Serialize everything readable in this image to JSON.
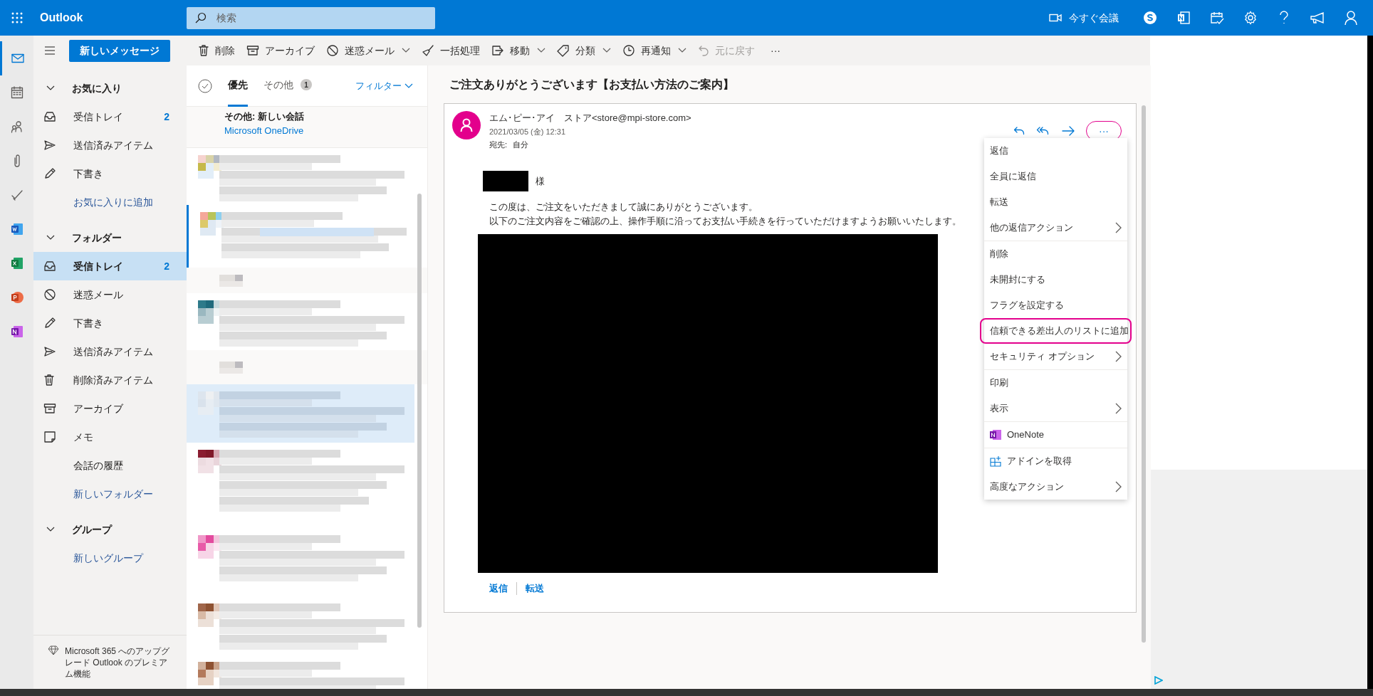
{
  "top_bar": {
    "app_name": "Outlook",
    "search": {
      "placeholder": "検索"
    },
    "meet_now": "今すぐ会議",
    "icons": [
      {
        "kind": "skype"
      },
      {
        "kind": "feed"
      },
      {
        "kind": "calendar-check"
      },
      {
        "kind": "settings"
      },
      {
        "kind": "help"
      },
      {
        "kind": "megaphone"
      },
      {
        "kind": "account"
      }
    ]
  },
  "app_rail": [
    {
      "kind": "mail",
      "selected": true
    },
    {
      "kind": "calendar",
      "selected": false
    },
    {
      "kind": "people",
      "selected": false
    },
    {
      "kind": "attach",
      "selected": false
    },
    {
      "kind": "todo",
      "selected": false
    },
    {
      "kind": "word",
      "selected": false
    },
    {
      "kind": "excel",
      "selected": false
    },
    {
      "kind": "powerpoint",
      "selected": false
    },
    {
      "kind": "onenote",
      "selected": false
    }
  ],
  "new_message_button": "新しいメッセージ",
  "toolbar": {
    "items": [
      {
        "label": "削除",
        "kind": "delete",
        "dropdown": false,
        "disabled": false
      },
      {
        "label": "アーカイブ",
        "kind": "archive",
        "dropdown": false,
        "disabled": false
      },
      {
        "label": "迷惑メール",
        "kind": "junk",
        "dropdown": true,
        "disabled": false
      },
      {
        "label": "一括処理",
        "kind": "sweep",
        "dropdown": false,
        "disabled": false
      },
      {
        "label": "移動",
        "kind": "move",
        "dropdown": true,
        "disabled": false
      },
      {
        "label": "分類",
        "kind": "tag",
        "dropdown": true,
        "disabled": false
      },
      {
        "label": "再通知",
        "kind": "snooze",
        "dropdown": true,
        "disabled": false
      },
      {
        "label": "元に戻す",
        "kind": "undo",
        "dropdown": false,
        "disabled": true
      }
    ],
    "more": "···"
  },
  "nav": {
    "sections": [
      {
        "title": "お気に入り",
        "expanded": true,
        "items": [
          {
            "label": "受信トレイ",
            "kind": "inbox",
            "count": "2",
            "selected": false
          },
          {
            "label": "送信済みアイテム",
            "kind": "sent",
            "selected": false
          },
          {
            "label": "下書き",
            "kind": "drafts",
            "selected": false
          },
          {
            "label": "お気に入りに追加",
            "kind": "link",
            "selected": false
          }
        ]
      },
      {
        "title": "フォルダー",
        "expanded": true,
        "items": [
          {
            "label": "受信トレイ",
            "kind": "inbox",
            "count": "2",
            "selected": true
          },
          {
            "label": "迷惑メール",
            "kind": "junk",
            "selected": false
          },
          {
            "label": "下書き",
            "kind": "drafts",
            "selected": false
          },
          {
            "label": "送信済みアイテム",
            "kind": "sent",
            "selected": false
          },
          {
            "label": "削除済みアイテム",
            "kind": "deleted",
            "selected": false
          },
          {
            "label": "アーカイブ",
            "kind": "archive",
            "selected": false
          },
          {
            "label": "メモ",
            "kind": "notes",
            "selected": false
          },
          {
            "label": "会話の履歴",
            "kind": "plain",
            "selected": false
          },
          {
            "label": "新しいフォルダー",
            "kind": "link",
            "selected": false
          }
        ]
      },
      {
        "title": "グループ",
        "expanded": true,
        "items": [
          {
            "label": "新しいグループ",
            "kind": "link",
            "selected": false
          }
        ]
      }
    ],
    "upgrade": "Microsoft 365 へのアップグレード Outlook のプレミアム機能"
  },
  "message_list": {
    "tabs": [
      {
        "label": "優先",
        "selected": true
      },
      {
        "label": "その他",
        "selected": false,
        "badge": "1"
      }
    ],
    "filter": "フィルター",
    "notice": {
      "title": "その他: 新しい会話",
      "sender": "Microsoft OneDrive"
    },
    "items": [
      {
        "kind": "message",
        "selected": false,
        "unread": false
      },
      {
        "kind": "message",
        "selected": false,
        "unread": true
      },
      {
        "kind": "header"
      },
      {
        "kind": "message",
        "selected": false,
        "unread": false
      },
      {
        "kind": "header"
      },
      {
        "kind": "message",
        "selected": true,
        "unread": false
      },
      {
        "kind": "message",
        "selected": false,
        "unread": false
      },
      {
        "kind": "message",
        "selected": false,
        "unread": false
      },
      {
        "kind": "message",
        "selected": false,
        "unread": false
      },
      {
        "kind": "message",
        "selected": false,
        "unread": false
      }
    ]
  },
  "reading_pane": {
    "subject": "ご注文ありがとうございます【お支払い方法のご案内】",
    "sender": "エム･ピー･アイ　ストア<store@mpi-store.com>",
    "date": "2021/03/05 (金) 12:31",
    "to_label": "宛先:",
    "to": "自分",
    "more_button": {
      "label": "···",
      "highlighted": true
    },
    "salutation": "様",
    "body": [
      "この度は、ご注文をいただきまして誠にありがとうございます。",
      "以下のご注文内容をご確認の上、操作手順に沿ってお支払い手続きを行っていただけますようお願いいたします。"
    ],
    "footer_actions": [
      "返信",
      "転送"
    ],
    "menu": {
      "groups": [
        [
          {
            "label": "返信",
            "kind": "plain",
            "highlighted": false
          },
          {
            "label": "全員に返信",
            "kind": "plain",
            "highlighted": false
          },
          {
            "label": "転送",
            "kind": "plain",
            "highlighted": false
          },
          {
            "label": "他の返信アクション",
            "kind": "submenu",
            "highlighted": false
          }
        ],
        [
          {
            "label": "削除",
            "kind": "plain",
            "highlighted": false
          },
          {
            "label": "未開封にする",
            "kind": "plain",
            "highlighted": false
          },
          {
            "label": "フラグを設定する",
            "kind": "plain",
            "highlighted": false
          },
          {
            "label": "信頼できる差出人のリストに追加",
            "kind": "plain",
            "highlighted": true
          },
          {
            "label": "セキュリティ オプション",
            "kind": "submenu",
            "highlighted": false
          }
        ],
        [
          {
            "label": "印刷",
            "kind": "plain",
            "highlighted": false
          },
          {
            "label": "表示",
            "kind": "submenu",
            "highlighted": false
          }
        ],
        [
          {
            "label": "OneNote",
            "kind": "onenote",
            "highlighted": false
          }
        ],
        [
          {
            "label": "アドインを取得",
            "kind": "addin",
            "highlighted": false
          },
          {
            "label": "高度なアクション",
            "kind": "submenu",
            "highlighted": false
          }
        ]
      ]
    }
  }
}
